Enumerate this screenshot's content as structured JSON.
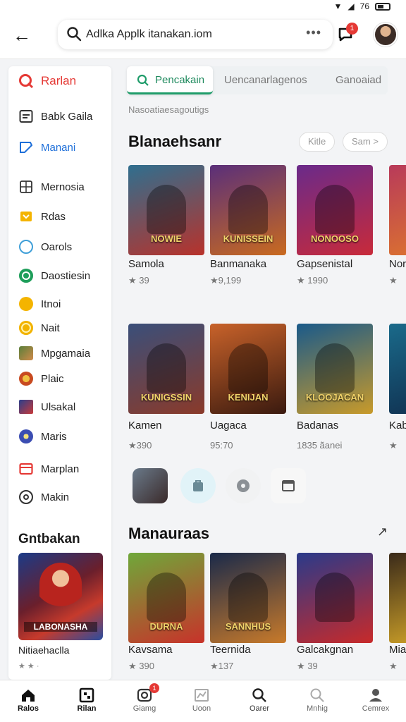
{
  "status": {
    "time": "76"
  },
  "search": {
    "query": "Adlka Applk itanakan.iom",
    "more": "•••"
  },
  "notifications": {
    "count": "1"
  },
  "sidebar": {
    "items": [
      {
        "label": "Rarlan",
        "icon": "q-logo-icon",
        "color": "#e53935"
      },
      {
        "label": "Babk Gaila",
        "icon": "list-icon",
        "color": "#333333"
      },
      {
        "label": "Manani",
        "icon": "tag-icon",
        "color": "#1e6fd9"
      },
      {
        "label": "Mernosia",
        "icon": "grid-icon",
        "color": "#333333"
      },
      {
        "label": "Rdas",
        "icon": "yellow-tag-icon",
        "color": "#f4b400"
      },
      {
        "label": "Oarols",
        "icon": "chat-bubble-icon",
        "color": "#3f9fd8"
      },
      {
        "label": "Daostiesin",
        "icon": "green-circle-icon",
        "color": "#1e9e5a"
      },
      {
        "label": "Itnoi",
        "icon": "orange-star-icon",
        "color": "#f4b400"
      },
      {
        "label": "Nait",
        "icon": "coin-icon",
        "color": "#f2b300"
      },
      {
        "label": "Mpgamaia",
        "icon": "game-thumb-icon",
        "color": "#5a7f3a"
      },
      {
        "label": "Plaic",
        "icon": "flame-icon",
        "color": "#e0702c"
      },
      {
        "label": "Ulsakal",
        "icon": "poster-icon",
        "color": "#2a3f8c"
      },
      {
        "label": "Maris",
        "icon": "star-burst-icon",
        "color": "#3b4db2"
      },
      {
        "label": "Marplan",
        "icon": "window-icon",
        "color": "#e53935"
      },
      {
        "label": "Makin",
        "icon": "ring-icon",
        "color": "#333333"
      }
    ],
    "section_title": "Gntbakan",
    "card": {
      "art_text": "LABONASHA",
      "name": "Nitiaehaclla",
      "rating": "★ ★ ·"
    }
  },
  "tabs": [
    {
      "label": "Pencakain",
      "active": true
    },
    {
      "label": "Uencanarlagenos",
      "active": false
    },
    {
      "label": "Ganoaiad",
      "active": false
    }
  ],
  "breadcrumb": "Nasoatiaesagoutigs",
  "section1": {
    "title": "Blanaehsanr",
    "filters": [
      "Kitle",
      "Sam >"
    ],
    "games": [
      {
        "name": "Samola",
        "rating": "★ 39",
        "art": "NOWIE",
        "c1": "#2f6f8f",
        "c2": "#b8322b"
      },
      {
        "name": "Banmanaka",
        "rating": "★9,199",
        "art": "KUNISSEIN",
        "c1": "#5a2f7a",
        "c2": "#c96a1f"
      },
      {
        "name": "Gapsenistal",
        "rating": "★ 1990",
        "art": "NONOOSO",
        "c1": "#6a2a8a",
        "c2": "#c82a3a"
      },
      {
        "name": "Nor",
        "rating": "★",
        "art": "",
        "c1": "#b83a5a",
        "c2": "#e07a2a"
      }
    ]
  },
  "section2": {
    "games": [
      {
        "name": "Kamen",
        "rating": "★390",
        "art": "KUNIGSSIN",
        "c1": "#3a4f7a",
        "c2": "#8a3a2a"
      },
      {
        "name": "Uagaca",
        "rating": "95:70",
        "art": "KENIJAN",
        "c1": "#c8622a",
        "c2": "#3a1a0f"
      },
      {
        "name": "Badanas",
        "rating": "1835 ãanei",
        "art": "KLOOJACAN",
        "c1": "#1a5a8a",
        "c2": "#c89a2a"
      },
      {
        "name": "Kab",
        "rating": "★",
        "art": "",
        "c1": "#1a6a8a",
        "c2": "#0f2a4a"
      }
    ]
  },
  "mini_icons": [
    "game-thumb",
    "bag-icon",
    "disc-icon",
    "window-icon"
  ],
  "section3": {
    "title": "Manauraas",
    "more": "↗",
    "games": [
      {
        "name": "Kavsama",
        "rating": "★ 390",
        "art": "DURNA",
        "c1": "#6fa83a",
        "c2": "#c8322a"
      },
      {
        "name": "Teernida",
        "rating": "★137",
        "art": "SANNHUS",
        "c1": "#1a2a4a",
        "c2": "#c87a2a"
      },
      {
        "name": "Galcakgnan",
        "rating": "★ 39",
        "art": "",
        "c1": "#2a3a8a",
        "c2": "#c82a2a"
      },
      {
        "name": "Mia",
        "rating": "★",
        "art": "",
        "c1": "#3a2a1a",
        "c2": "#e0b02a"
      }
    ]
  },
  "bottom_nav": [
    {
      "label": "Ralos",
      "icon": "home-icon",
      "active": true
    },
    {
      "label": "Rilan",
      "icon": "board-icon",
      "active": true
    },
    {
      "label": "Giamg",
      "icon": "camera-icon",
      "active": false,
      "badge": "1"
    },
    {
      "label": "Uoon",
      "icon": "chart-icon",
      "active": false
    },
    {
      "label": "Oarer",
      "icon": "search-icon",
      "active": true
    },
    {
      "label": "Mnhig",
      "icon": "search-alt-icon",
      "active": false
    },
    {
      "label": "Cemrex",
      "icon": "person-icon",
      "active": false
    }
  ]
}
